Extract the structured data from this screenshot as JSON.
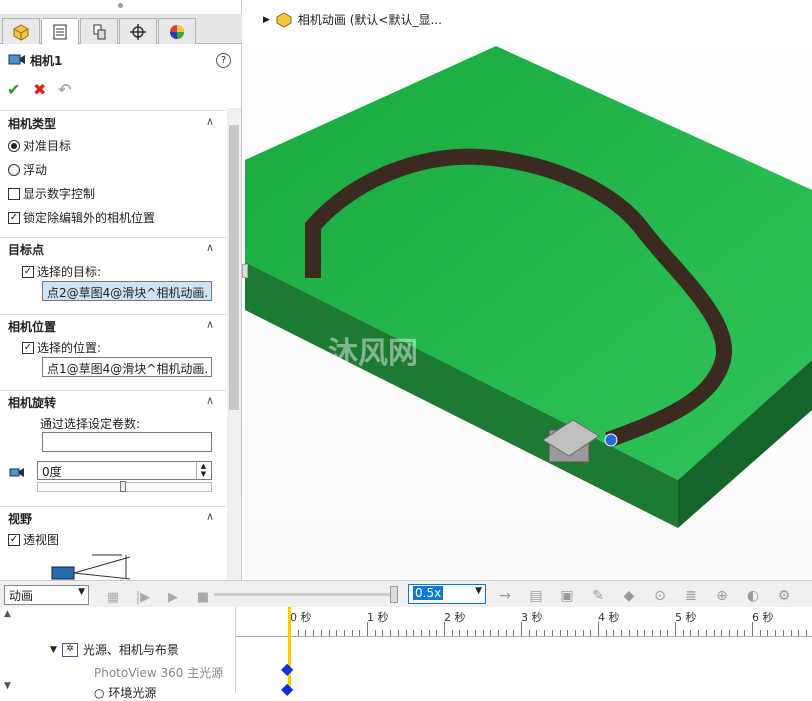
{
  "panel": {
    "title": "相机1",
    "tabs": [
      "part-icon",
      "property-icon",
      "config-icon",
      "target-icon",
      "appearance-icon"
    ],
    "help": "?"
  },
  "camera_type": {
    "header": "相机类型",
    "radio_aim": "对准目标",
    "radio_float": "浮动",
    "show_numeric": "显示数字控制",
    "lock_position": "锁定除编辑外的相机位置"
  },
  "target": {
    "header": "目标点",
    "checkbox": "选择的目标:",
    "value": "点2@草图4@滑块^相机动画."
  },
  "position": {
    "header": "相机位置",
    "checkbox": "选择的位置:",
    "value": "点1@草图4@滑块^相机动画."
  },
  "rotation": {
    "header": "相机旋转",
    "label": "通过选择设定卷数:",
    "angle": "0度"
  },
  "field_of_view": {
    "header": "视野",
    "checkbox": "透视图"
  },
  "viewport": {
    "tree_label": "相机动画 (默认<默认_显..."
  },
  "motion": {
    "study_type": "动画",
    "speed": "0.5x",
    "ticks": [
      "0 秒",
      "1 秒",
      "2 秒",
      "3 秒",
      "4 秒",
      "5 秒",
      "6 秒"
    ],
    "tree_items": [
      "光源、相机与布景",
      "PhotoView 360 主光源",
      "环境光源"
    ]
  },
  "colors": {
    "accent": "#0a7ad6",
    "plate": "#22b14c",
    "plate_dark": "#1a8a3a",
    "slot": "#3a2a20"
  }
}
